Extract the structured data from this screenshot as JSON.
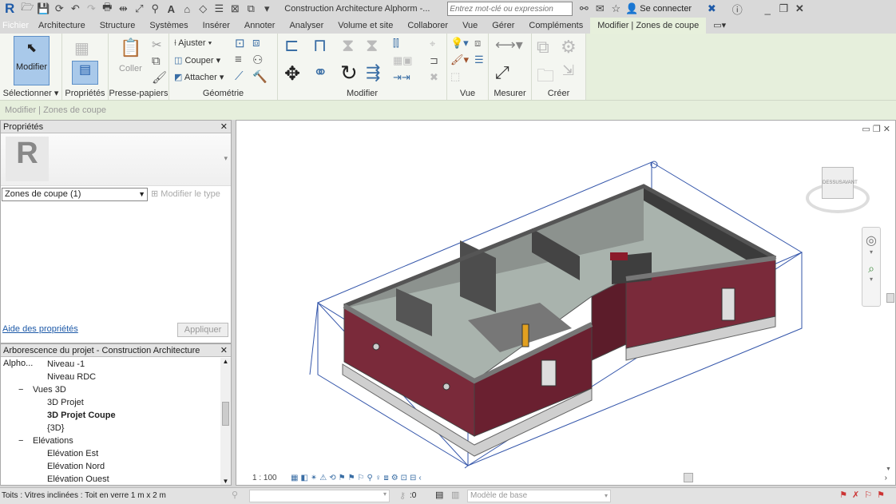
{
  "titlebar": {
    "app_icon": "R",
    "title": "Construction Architecture Alphorm -...",
    "search_placeholder": "Entrez mot-clé ou expression",
    "sign_in": "Se connecter",
    "quick_access_icons": [
      "open-icon",
      "save-icon",
      "sync-icon",
      "undo-icon",
      "redo-icon",
      "print-icon",
      "measure-icon",
      "dimension-icon",
      "tag-icon",
      "text-icon",
      "3d-view-icon",
      "section-icon",
      "thin-lines-icon",
      "close-hidden-icon",
      "switch-windows-icon",
      "customize-icon"
    ]
  },
  "tabs": [
    "Fichier",
    "Architecture",
    "Structure",
    "Systèmes",
    "Insérer",
    "Annoter",
    "Analyser",
    "Volume et site",
    "Collaborer",
    "Vue",
    "Gérer",
    "Compléments",
    "Modifier | Zones de coupe"
  ],
  "active_tab": "Modifier | Zones de coupe",
  "ribbon": {
    "modify": "Modifier",
    "select": "Sélectionner",
    "properties": "Propriétés",
    "paste": "Coller",
    "clipboard": "Presse-papiers",
    "geometry": {
      "label": "Géométrie",
      "items": [
        "Ajuster",
        "Couper",
        "Attacher"
      ]
    },
    "modify_panel": "Modifier",
    "view_panel": "Vue",
    "measure_panel": "Mesurer",
    "create_panel": "Créer"
  },
  "context_bar": "Modifier | Zones de coupe",
  "properties": {
    "title": "Propriétés",
    "type_selector": "Zones de coupe (1)",
    "edit_type": "Modifier le type",
    "help_link": "Aide des propriétés",
    "apply": "Appliquer"
  },
  "browser": {
    "title": "Arborescence du projet - Construction Architecture Alpho...",
    "items": [
      {
        "label": "Niveau -1",
        "level": 2
      },
      {
        "label": "Niveau RDC",
        "level": 2
      },
      {
        "label": "Vues 3D",
        "level": 1,
        "expander": "−"
      },
      {
        "label": "3D Projet",
        "level": 2
      },
      {
        "label": "3D Projet Coupe",
        "level": 2,
        "bold": true
      },
      {
        "label": "{3D}",
        "level": 2
      },
      {
        "label": "Elévations",
        "level": 1,
        "expander": "−"
      },
      {
        "label": "Elévation Est",
        "level": 2
      },
      {
        "label": "Elévation Nord",
        "level": 2
      },
      {
        "label": "Elévation Ouest",
        "level": 2
      }
    ]
  },
  "viewport": {
    "scale": "1 : 100",
    "viewcube_labels": [
      "DESSUS",
      "AVANT"
    ]
  },
  "status": {
    "message": "Toits : Vitres inclinées : Toit en verre 1 m x 2 m",
    "selection_count": ":0",
    "model": "Modèle de base"
  },
  "colors": {
    "ribbon_bg": "#e6efdc",
    "accent": "#3a6ea5",
    "wall": "#7a2a3a",
    "section_box": "#3355aa"
  }
}
